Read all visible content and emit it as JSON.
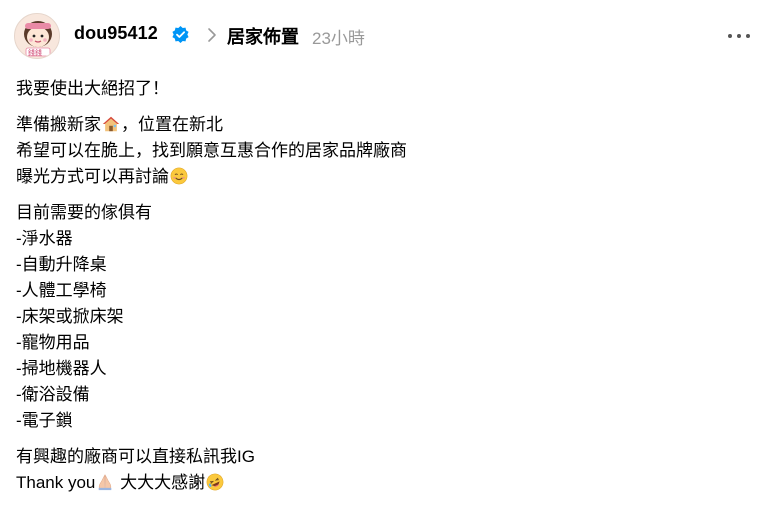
{
  "post": {
    "username": "dou95412",
    "topic": "居家佈置",
    "time": "23小時",
    "avatar_text": "錢錢",
    "icons": {
      "verified": "verified-badge-icon",
      "chevron": "chevron-right-icon",
      "more": "more-options-icon",
      "house": "house-emoji-icon",
      "smile": "smiling-face-emoji-icon",
      "pray": "folded-hands-emoji-icon",
      "laugh": "rolling-laughing-emoji-icon"
    },
    "colors": {
      "verified": "#0095f6",
      "muted": "#999999",
      "text": "#000000"
    }
  },
  "body": {
    "p1": "我要使出大絕招了！",
    "p2_l1": "準備搬新家",
    "p2_l1b": "，位置在新北",
    "p2_l2": "希望可以在脆上，找到願意互惠合作的居家品牌廠商",
    "p2_l3": "曝光方式可以再討論",
    "p3_head": "目前需要的傢俱有",
    "items": [
      "-淨水器",
      "-自動升降桌",
      "-人體工學椅",
      "-床架或掀床架",
      "-寵物用品",
      "-掃地機器人",
      "-衛浴設備",
      "-電子鎖"
    ],
    "p4_l1": "有興趣的廠商可以直接私訊我IG",
    "p4_l2a": "Thank you",
    "p4_l2b": " 大大大感謝"
  }
}
